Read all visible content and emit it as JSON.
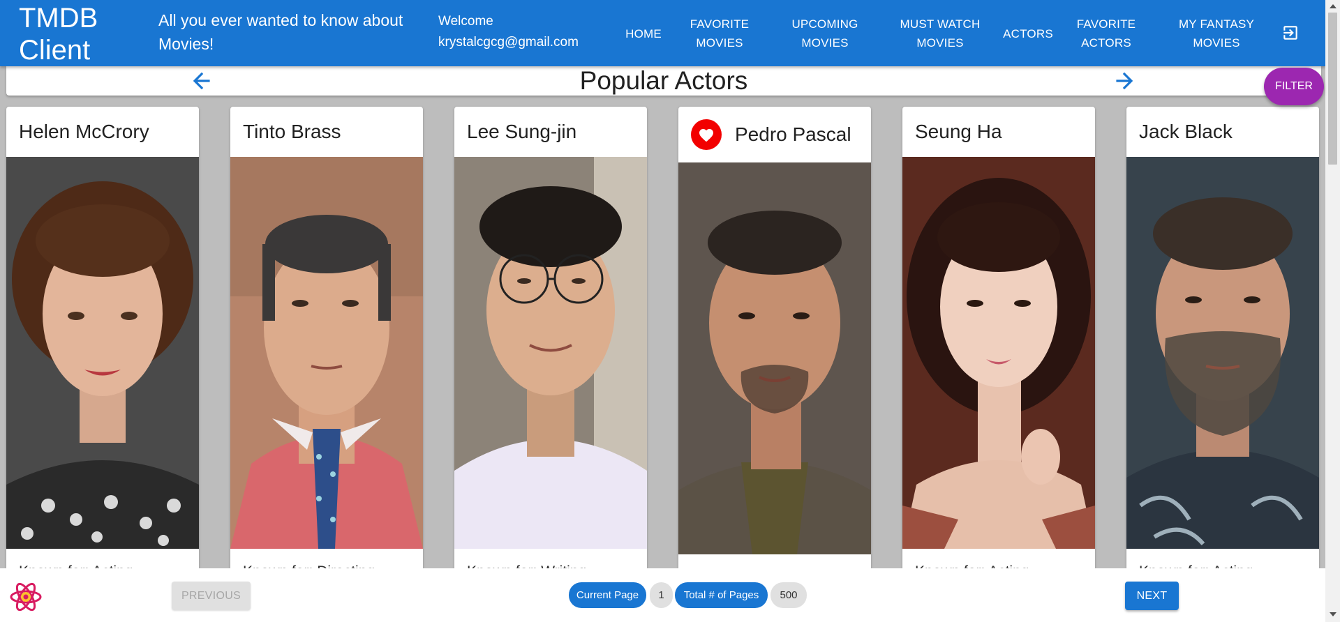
{
  "header": {
    "brand": "TMDB Client",
    "tagline": "All you ever wanted to know about Movies!",
    "welcome_label": "Welcome",
    "user_email": "krystalcgcg@gmail.com",
    "nav": [
      {
        "label": "Home"
      },
      {
        "label": "Favorite Movies"
      },
      {
        "label": "Upcoming Movies"
      },
      {
        "label": "Must Watch Movies"
      },
      {
        "label": "Actors"
      },
      {
        "label": "Favorite Actors"
      },
      {
        "label": "My Fantasy Movies"
      }
    ],
    "logout_icon": "logout-icon"
  },
  "page": {
    "title": "Popular Actors",
    "filter_label": "FILTER",
    "prev_arrow_icon": "arrow-left-icon",
    "next_arrow_icon": "arrow-right-icon"
  },
  "actors": [
    {
      "name": "Helen McCrory",
      "subtitle": "Known for: Acting",
      "favorite": false
    },
    {
      "name": "Tinto Brass",
      "subtitle": "Known for: Directing",
      "favorite": false
    },
    {
      "name": "Lee Sung-jin",
      "subtitle": "Known for: Writing",
      "favorite": false
    },
    {
      "name": "Pedro Pascal",
      "subtitle": "",
      "favorite": true
    },
    {
      "name": "Seung Ha",
      "subtitle": "Known for: Acting",
      "favorite": false
    },
    {
      "name": "Jack Black",
      "subtitle": "Known for: Acting",
      "favorite": false
    }
  ],
  "pagination": {
    "previous_label": "Previous",
    "next_label": "Next",
    "current_page_label": "Current Page",
    "current_page": "1",
    "total_pages_label": "Total # of Pages",
    "total_pages": "500"
  },
  "colors": {
    "primary": "#1976d2",
    "secondary": "#9c27b0",
    "favorite": "#f20000",
    "background": "#bdbdbd"
  }
}
